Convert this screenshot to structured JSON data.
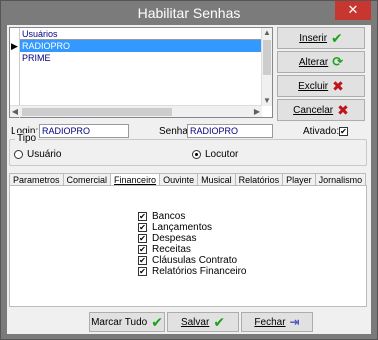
{
  "window": {
    "title": "Habilitar Senhas",
    "close": "✕"
  },
  "grid": {
    "header": "Usuários",
    "rows": [
      "RADIOPRO",
      "PRIME"
    ]
  },
  "side_buttons": {
    "inserir": "Inserir",
    "alterar": "Alterar",
    "excluir": "Excluir",
    "cancelar": "Cancelar"
  },
  "login": {
    "label": "Login:",
    "value": "RADIOPRO"
  },
  "senha": {
    "label": "Senha:",
    "value": "RADIOPRO"
  },
  "ativado": {
    "label": "Ativado:",
    "checked": true
  },
  "tipo": {
    "legend": "Tipo",
    "options": [
      "Usuário",
      "Locutor"
    ],
    "selected": "Locutor"
  },
  "tabs": [
    "Parametros",
    "Comercial",
    "Financeiro",
    "Ouvinte",
    "Musical",
    "Relatórios",
    "Player",
    "Jornalismo"
  ],
  "active_tab": "Financeiro",
  "permissions": [
    "Bancos",
    "Lançamentos",
    "Despesas",
    "Receitas",
    "Cláusulas Contrato",
    "Relatórios Financeiro"
  ],
  "bottom_buttons": {
    "marcar_tudo": "Marcar Tudo",
    "salvar": "Salvar",
    "fechar": "Fechar"
  },
  "glyphs": {
    "check": "✔",
    "refresh": "⟳",
    "x": "✖",
    "exit": "⇥",
    "row_marker": "▶",
    "up": "▲",
    "down": "▼",
    "left": "◀",
    "right": "▶"
  }
}
